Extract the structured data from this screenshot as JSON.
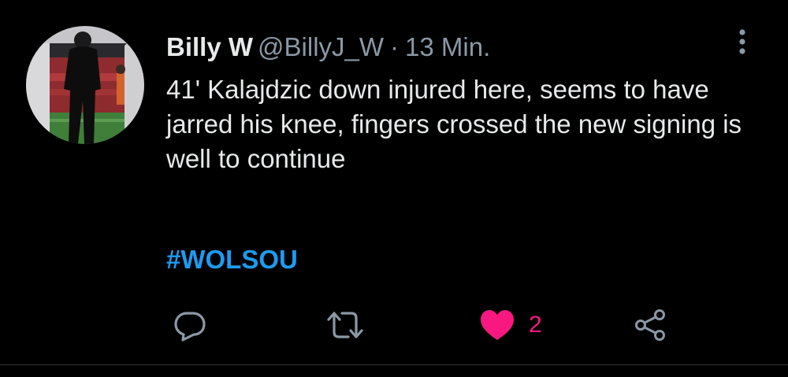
{
  "tweet": {
    "author": {
      "display_name": "Billy W",
      "handle": "@BillyJ_W"
    },
    "separator": "·",
    "timestamp": "13 Min.",
    "body": "41' Kalajdzic down injured here, seems to have jarred his knee, fingers crossed the new signing is well to continue",
    "hashtag": "#WOLSOU",
    "more_icon": "more-vertical-icon",
    "actions": {
      "reply_icon": "reply-icon",
      "retweet_icon": "retweet-icon",
      "like_icon": "heart-filled-icon",
      "like_count": "2",
      "share_icon": "share-icon"
    }
  },
  "colors": {
    "background": "#000000",
    "text_primary": "#e7e9ea",
    "text_secondary": "#8b98a5",
    "link": "#1d9bf0",
    "like": "#f91880"
  }
}
